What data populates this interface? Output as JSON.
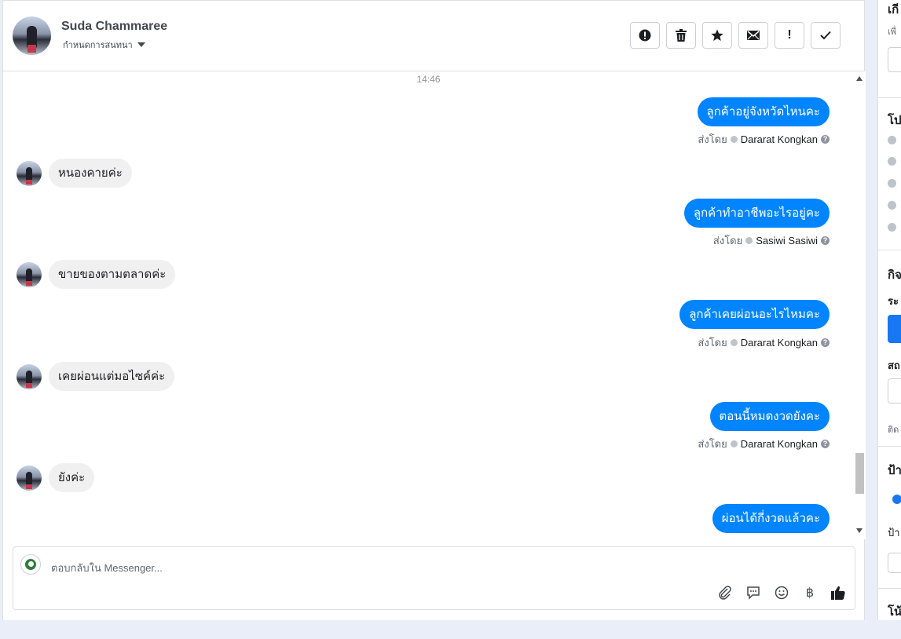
{
  "header": {
    "contact_name": "Suda Chammaree",
    "assign_label": "กำหนดการสนทนา",
    "toolbar": [
      {
        "name": "spam-button",
        "icon": "alert-circle-icon",
        "glyph": ""
      },
      {
        "name": "delete-button",
        "icon": "trash-icon",
        "glyph": ""
      },
      {
        "name": "star-button",
        "icon": "star-icon",
        "glyph": ""
      },
      {
        "name": "mark-unread-button",
        "icon": "envelope-icon",
        "glyph": ""
      },
      {
        "name": "follow-up-button",
        "icon": "exclamation-icon",
        "glyph": "!"
      },
      {
        "name": "mark-done-button",
        "icon": "check-icon",
        "glyph": ""
      }
    ]
  },
  "chat": {
    "timestamp": "14:46",
    "sent_by_label": "ส่งโดย",
    "messages": [
      {
        "dir": "out",
        "text": "ลูกค้าอยู่จังหวัดไหนคะ",
        "agent": "Dararat Kongkan"
      },
      {
        "dir": "in",
        "text": "หนองคายค่ะ"
      },
      {
        "dir": "out",
        "text": "ลูกค้าทำอาชีพอะไรอยู่คะ",
        "agent": "Sasiwi Sasiwi"
      },
      {
        "dir": "in",
        "text": "ขายของตามตลาดค่ะ"
      },
      {
        "dir": "out",
        "text": "ลูกค้าเคยผ่อนอะไรไหมคะ",
        "agent": "Dararat Kongkan"
      },
      {
        "dir": "in",
        "text": "เคยผ่อนแต่มอไซค์ค่ะ"
      },
      {
        "dir": "out",
        "text": "ตอนนี้หมดงวดยังคะ",
        "agent": "Dararat Kongkan"
      },
      {
        "dir": "in",
        "text": "ยังค่ะ"
      },
      {
        "dir": "out",
        "text": "ผ่อนได้กี่งวดแล้วคะ"
      }
    ]
  },
  "composer": {
    "placeholder": "ตอบกลับใน Messenger...",
    "currency_glyph": "฿"
  },
  "sidebar": {
    "headings": [
      "เกี",
      "โป",
      "กิจ",
      "ระ",
      "สถ",
      "ป้า",
      "ป้า",
      "โน้"
    ],
    "sub_texts": [
      "เพื่",
      "ติด"
    ]
  },
  "colors": {
    "accent": "#0084ff",
    "incoming_bubble": "#f1f0f0",
    "background": "#e9eef8"
  }
}
